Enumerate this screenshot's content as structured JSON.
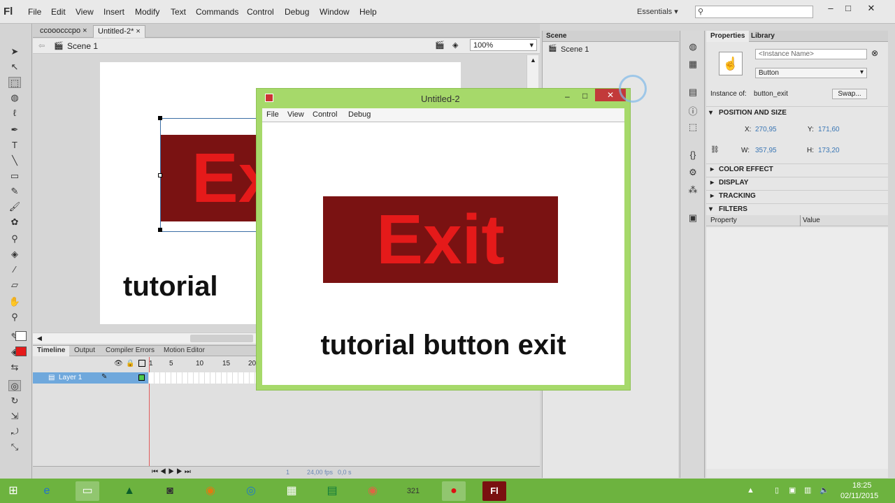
{
  "app": {
    "logo": "Fl"
  },
  "menu": [
    "File",
    "Edit",
    "View",
    "Insert",
    "Modify",
    "Text",
    "Commands",
    "Control",
    "Debug",
    "Window",
    "Help"
  ],
  "workspace": "Essentials",
  "search": {
    "icon": "search-icon",
    "value": ""
  },
  "window_controls": {
    "minimize": "–",
    "maximize": "□",
    "close": "✕"
  },
  "doc_tabs": [
    {
      "label": "ccooocccpo"
    },
    {
      "label": "Untitled-2*"
    }
  ],
  "scene_label": "Scene 1",
  "zoom": "100%",
  "stage": {
    "button_text": "Exit",
    "caption": "tutorial"
  },
  "timeline": {
    "tabs": [
      "Timeline",
      "Output",
      "Compiler Errors",
      "Motion Editor"
    ],
    "frame_ticks": [
      "1",
      "5",
      "10",
      "15",
      "20"
    ],
    "layer": "Layer 1",
    "fps": "24,00 fps",
    "time": "0,0 s",
    "frame": "1"
  },
  "scene_panel": {
    "title": "Scene",
    "item": "Scene 1"
  },
  "properties": {
    "tabs": [
      "Properties",
      "Library"
    ],
    "instance_name_placeholder": "<Instance Name>",
    "type": "Button",
    "instance_of_label": "Instance of:",
    "instance_of": "button_exit",
    "swap": "Swap...",
    "position_size": "POSITION AND SIZE",
    "x_label": "X:",
    "x": "270,95",
    "y_label": "Y:",
    "y": "171,60",
    "w_label": "W:",
    "w": "357,95",
    "h_label": "H:",
    "h": "173,20",
    "sections": [
      "COLOR EFFECT",
      "DISPLAY",
      "TRACKING",
      "FILTERS"
    ],
    "filter_cols": [
      "Property",
      "Value"
    ]
  },
  "popup": {
    "title": "Untitled-2",
    "menu": [
      "File",
      "View",
      "Control",
      "Debug"
    ],
    "button_text": "Exit",
    "caption": "tutorial button exit"
  },
  "taskbar": {
    "icons": [
      "windows-start-icon",
      "ie-icon",
      "file-explorer-icon",
      "app-green-icon",
      "camera-icon",
      "firefox-icon",
      "app-ring-icon",
      "apps-grid-icon",
      "excel-icon",
      "chrome-icon",
      "video-321-icon",
      "recorder-icon",
      "flash-icon"
    ],
    "time": "18:25",
    "date": "02/11/2015"
  },
  "colors": {
    "accent_red": "#e51a1a",
    "button_bg": "#7a1212",
    "window_green": "#a6d96a",
    "taskbar": "#6db33f"
  }
}
